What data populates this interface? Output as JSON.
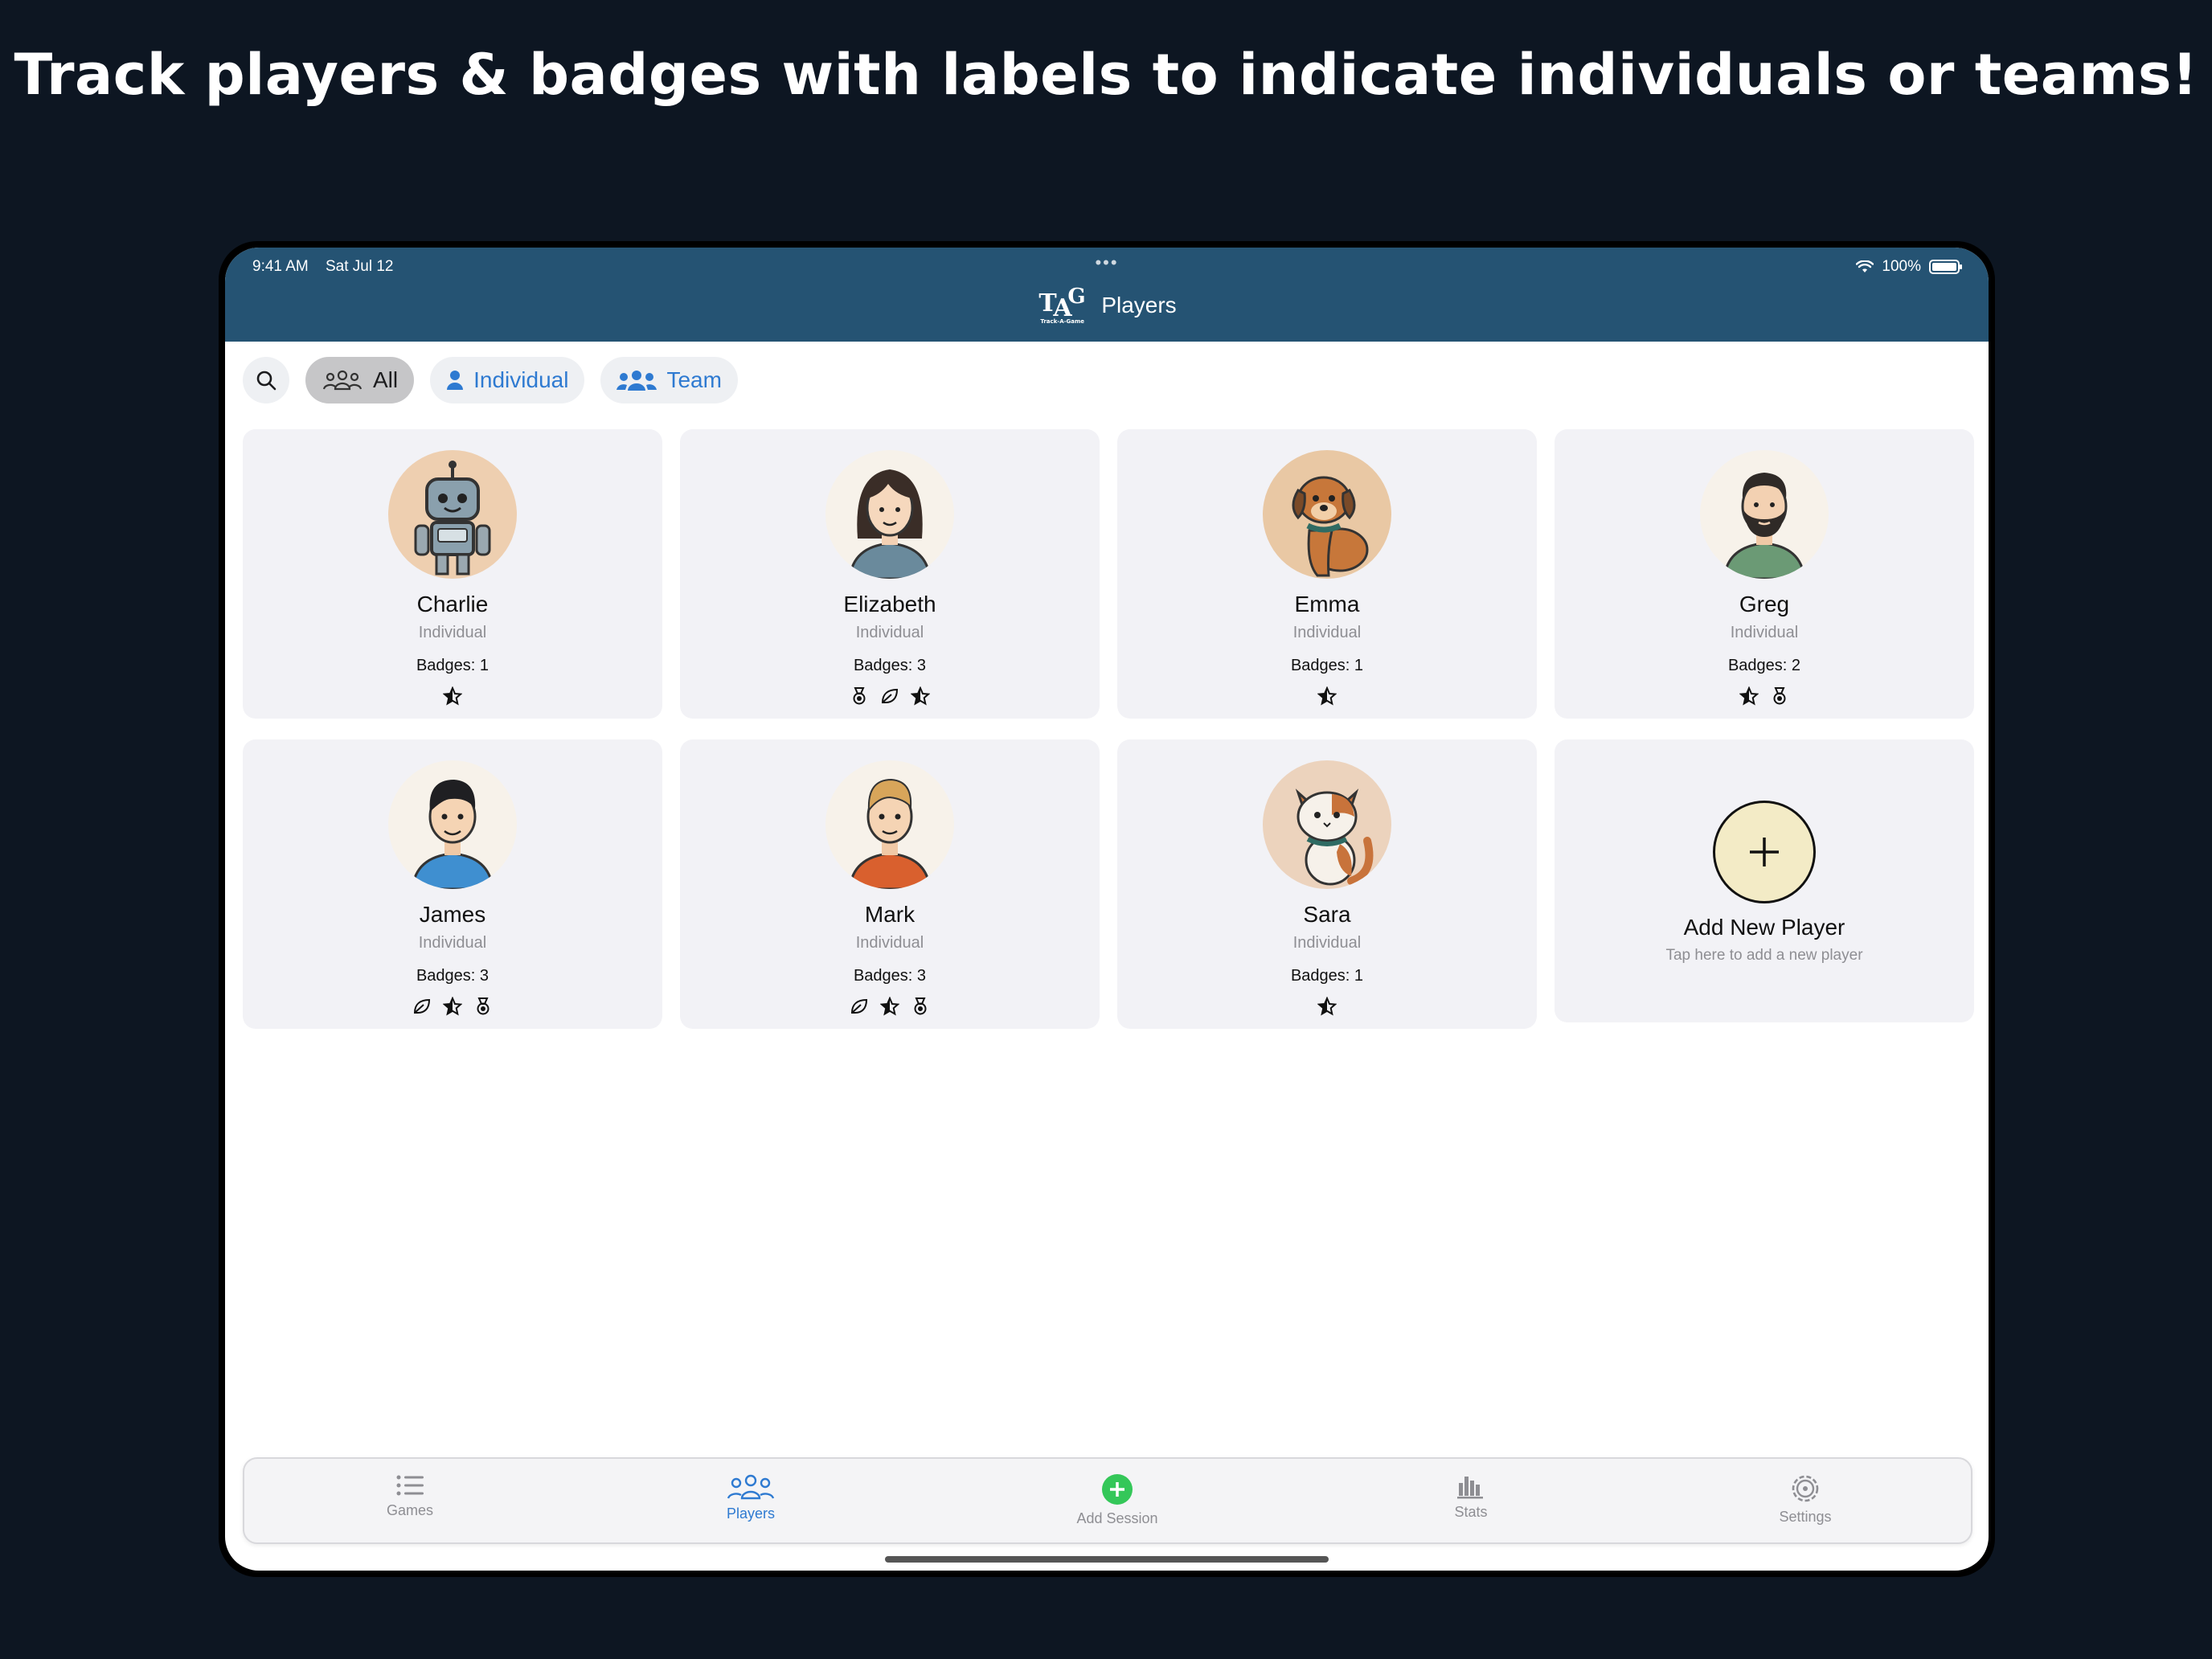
{
  "headline": "Track players & badges with labels to indicate individuals or teams!",
  "status_bar": {
    "time": "9:41 AM",
    "date": "Sat Jul 12",
    "battery": "100%"
  },
  "header": {
    "logo_text": "Track-A-Game",
    "title": "Players"
  },
  "filters": {
    "all": "All",
    "individual": "Individual",
    "team": "Team"
  },
  "players": [
    {
      "name": "Charlie",
      "type": "Individual",
      "badges_label": "Badges: 1",
      "badge_icons": [
        "star-icon"
      ],
      "avatar": "robot"
    },
    {
      "name": "Elizabeth",
      "type": "Individual",
      "badges_label": "Badges: 3",
      "badge_icons": [
        "medal-icon",
        "leaf-icon",
        "star-icon"
      ],
      "avatar": "woman"
    },
    {
      "name": "Emma",
      "type": "Individual",
      "badges_label": "Badges: 1",
      "badge_icons": [
        "star-icon"
      ],
      "avatar": "dog"
    },
    {
      "name": "Greg",
      "type": "Individual",
      "badges_label": "Badges: 2",
      "badge_icons": [
        "star-icon",
        "medal-icon"
      ],
      "avatar": "bearded-man"
    },
    {
      "name": "James",
      "type": "Individual",
      "badges_label": "Badges: 3",
      "badge_icons": [
        "leaf-icon",
        "star-icon",
        "medal-icon"
      ],
      "avatar": "boy"
    },
    {
      "name": "Mark",
      "type": "Individual",
      "badges_label": "Badges: 3",
      "badge_icons": [
        "leaf-icon",
        "star-icon",
        "medal-icon"
      ],
      "avatar": "man"
    },
    {
      "name": "Sara",
      "type": "Individual",
      "badges_label": "Badges: 1",
      "badge_icons": [
        "star-icon"
      ],
      "avatar": "cat"
    }
  ],
  "add_player": {
    "title": "Add New Player",
    "subtitle": "Tap here to add a new player"
  },
  "tabs": {
    "games": "Games",
    "players": "Players",
    "add_session": "Add Session",
    "stats": "Stats",
    "settings": "Settings"
  },
  "colors": {
    "header": "#255373",
    "accent": "#2e7ad1",
    "add_session": "#34c759",
    "background": "#0d1622"
  }
}
